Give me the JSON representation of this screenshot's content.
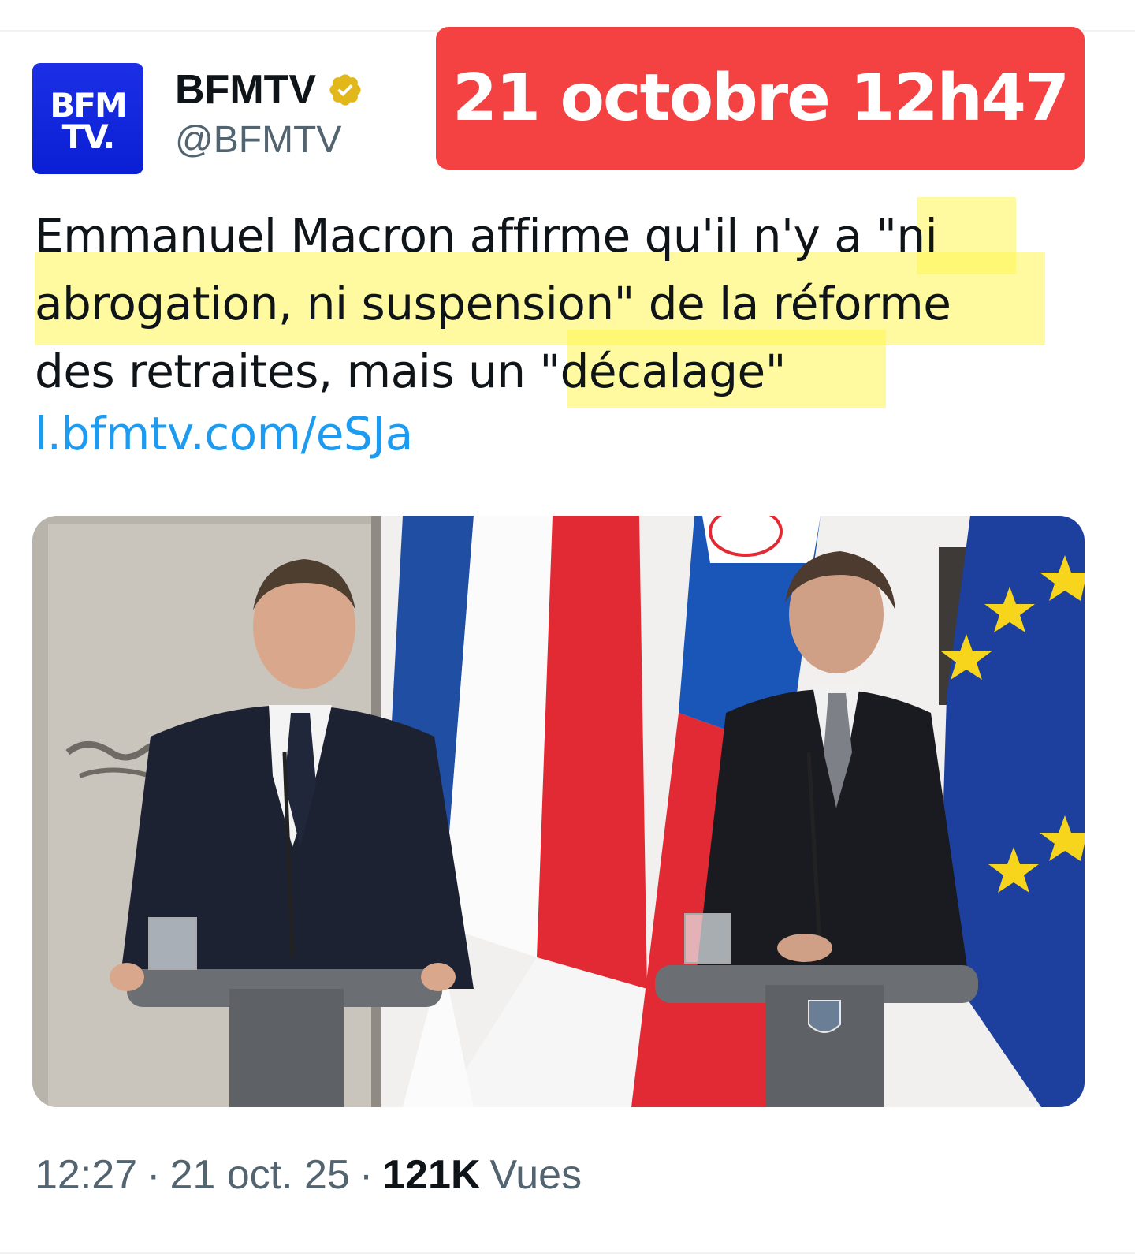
{
  "account": {
    "avatar_line1": "BFM",
    "avatar_line2": "TV.",
    "display_name": "BFMTV",
    "handle": "@BFMTV",
    "verified_icon": "gold-verified-badge-icon"
  },
  "stamp": {
    "text": "21 octobre 12h47",
    "color": "#f44242"
  },
  "tweet": {
    "lines": [
      "Emmanuel Macron affirme qu'il n'y a \"ni",
      "abrogation, ni suspension\" de la réforme",
      "des retraites, mais un \"décalage\""
    ],
    "link": "l.bfmtv.com/eSJa",
    "highlight_color": "#fff552"
  },
  "media": {
    "description_icon": "photo-press-conference"
  },
  "meta": {
    "time": "12:27",
    "separator": "·",
    "date": "21 oct. 25",
    "views_count": "121K",
    "views_label": "Vues"
  },
  "colors": {
    "link": "#1d9bf0",
    "secondary_text": "#536471",
    "primary_text": "#0f1419",
    "brand_blue": "#0a1fd3"
  }
}
